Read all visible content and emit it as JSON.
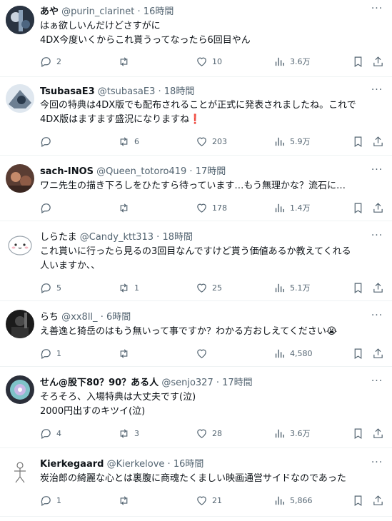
{
  "icons": {
    "reply": "reply-icon",
    "retweet": "retweet-icon",
    "like": "heart-icon",
    "views": "views-icon",
    "bookmark": "bookmark-icon",
    "share": "share-icon",
    "more": "more-icon"
  },
  "colors": {
    "text": "#0f1419",
    "secondary": "#536471",
    "divider": "#eff3f4",
    "emoji_red": "#f4212e"
  },
  "tweets": [
    {
      "name": "あや",
      "handle": "@purin_clarinet",
      "dot": "·",
      "time": "16時間",
      "lines": [
        "はぁ欲しいんだけどさすがに",
        "4DX今度いくからこれ貰うってなったら6回目やん"
      ],
      "reply": "2",
      "retweet": "",
      "like": "10",
      "views": "3.6万"
    },
    {
      "name": "TsubasaE3",
      "handle": "@tsubasaE3",
      "dot": "·",
      "time": "18時間",
      "lines": [
        "今回の特典は4DX版でも配布されることが正式に発表されましたね。これで",
        "4DX版はますます盛況になりますね"
      ],
      "emoji": "❗",
      "reply": "",
      "retweet": "6",
      "like": "203",
      "views": "5.9万"
    },
    {
      "name": "sach-INOS",
      "handle": "@Queen_totoro419",
      "dot": "·",
      "time": "17時間",
      "lines": [
        "ワニ先生の描き下ろしをひたすら待っています…もう無理かな？流石に…"
      ],
      "reply": "",
      "retweet": "",
      "like": "178",
      "views": "1.4万"
    },
    {
      "name": "しらたま",
      "handle": "@Candy_ktt313",
      "dot": "·",
      "time": "18時間",
      "lines": [
        "これ貰いに行ったら見るの3回目なんですけど貰う価値あるか教えてくれる",
        "人いますか、、"
      ],
      "reply": "5",
      "retweet": "1",
      "like": "25",
      "views": "5.1万"
    },
    {
      "name": "らち",
      "handle": "@xx8ll_",
      "dot": "·",
      "time": "6時間",
      "lines": [
        "え善逸と猗岳のはもう無いって事ですか？わかる方おしえてください😭"
      ],
      "reply": "1",
      "retweet": "",
      "like": "",
      "views": "4,580"
    },
    {
      "name": "せん@股下80？90？ある人",
      "handle": "@senjo327",
      "dot": "·",
      "time": "17時間",
      "lines": [
        "そろそろ、入場特典は大丈夫です(泣)",
        "2000円出すのキツイ(泣)"
      ],
      "reply": "4",
      "retweet": "3",
      "like": "28",
      "views": "3.6万"
    },
    {
      "name": "Kierkegaard",
      "handle": "@Kierkelove",
      "dot": "·",
      "time": "16時間",
      "lines": [
        "炭治郎の綺麗な心とは裏腹に商魂たくましい映画通営サイドなのであった"
      ],
      "reply": "1",
      "retweet": "",
      "like": "21",
      "views": "5,866"
    }
  ]
}
